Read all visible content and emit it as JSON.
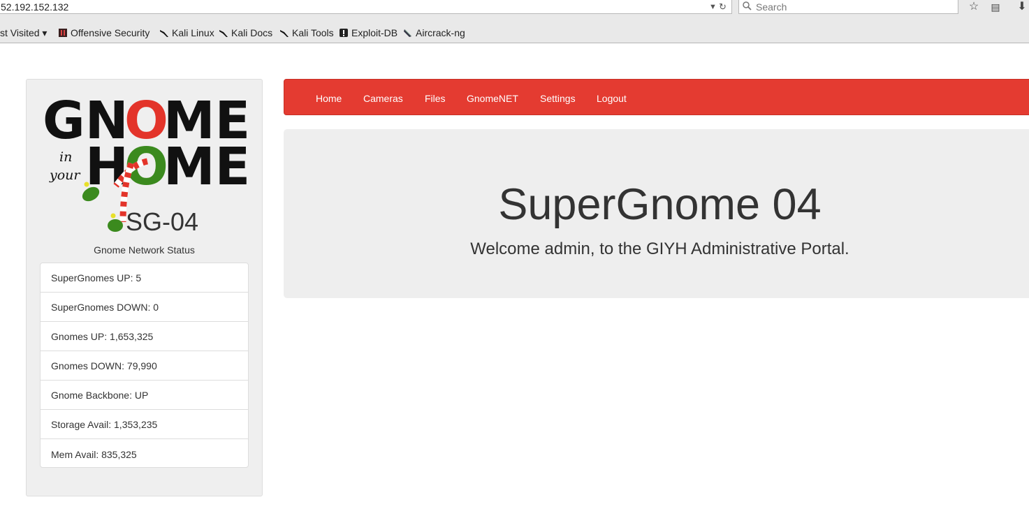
{
  "browser": {
    "url": "52.192.152.132",
    "search_placeholder": "Search",
    "bookmarks": [
      {
        "label": "st Visited ▾",
        "icon": ""
      },
      {
        "label": "Offensive Security",
        "icon": "offensive-security-icon"
      },
      {
        "label": "Kali Linux",
        "icon": "kali-dragon-icon"
      },
      {
        "label": "Kali Docs",
        "icon": "kali-dragon-icon"
      },
      {
        "label": "Kali Tools",
        "icon": "kali-dragon-icon"
      },
      {
        "label": "Exploit-DB",
        "icon": "exploit-db-icon"
      },
      {
        "label": "Aircrack-ng",
        "icon": "aircrack-icon"
      }
    ]
  },
  "sidebar": {
    "logo_text": {
      "line1": "GNOME",
      "in": "in",
      "your": "your",
      "line2": "HOME"
    },
    "device_id": "SG-04",
    "status_title": "Gnome Network Status",
    "status_items": [
      "SuperGnomes UP: 5",
      "SuperGnomes DOWN: 0",
      "Gnomes UP: 1,653,325",
      "Gnomes DOWN: 79,990",
      "Gnome Backbone: UP",
      "Storage Avail: 1,353,235",
      "Mem Avail: 835,325"
    ]
  },
  "nav": {
    "items": [
      "Home",
      "Cameras",
      "Files",
      "GnomeNET",
      "Settings",
      "Logout"
    ]
  },
  "jumbotron": {
    "title": "SuperGnome 04",
    "subtitle": "Welcome admin, to the GIYH Administrative Portal."
  },
  "colors": {
    "navbar": "#e43b31",
    "logo_red": "#e3342a",
    "logo_green": "#3b8a1e",
    "jumbotron_bg": "#eeeeee"
  }
}
